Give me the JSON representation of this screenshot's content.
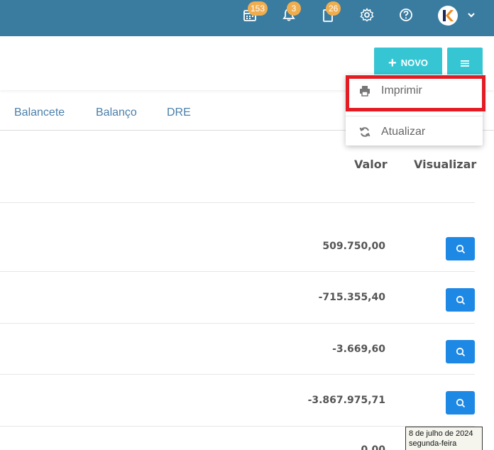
{
  "topbar": {
    "calendar_badge": "153",
    "bell_badge": "3",
    "clipboard_badge": "26",
    "avatar_letter": "K",
    "bg_color": "#3a7ca0",
    "badge_color": "#f0ad4e"
  },
  "actions": {
    "novo_label": "NOVO",
    "novo_color": "#36c6d3"
  },
  "dropdown": {
    "items": [
      {
        "label": "Imprimir",
        "icon": "printer-icon"
      },
      {
        "label": "Atualizar",
        "icon": "refresh-icon"
      }
    ],
    "highlight_color": "#e41b23"
  },
  "tabs": [
    "Balancete",
    "Balanço",
    "DRE"
  ],
  "table": {
    "headers": {
      "valor": "Valor",
      "visualizar": "Visualizar"
    },
    "rows": [
      {
        "valor": "509.750,00"
      },
      {
        "valor": "-715.355,40"
      },
      {
        "valor": "-3.669,60"
      },
      {
        "valor": "-3.867.975,71"
      },
      {
        "valor": "0,00"
      }
    ],
    "view_button_color": "#1e88e5"
  },
  "tooltip": {
    "line1": "8 de julho de 2024",
    "line2": "segunda-feira"
  }
}
